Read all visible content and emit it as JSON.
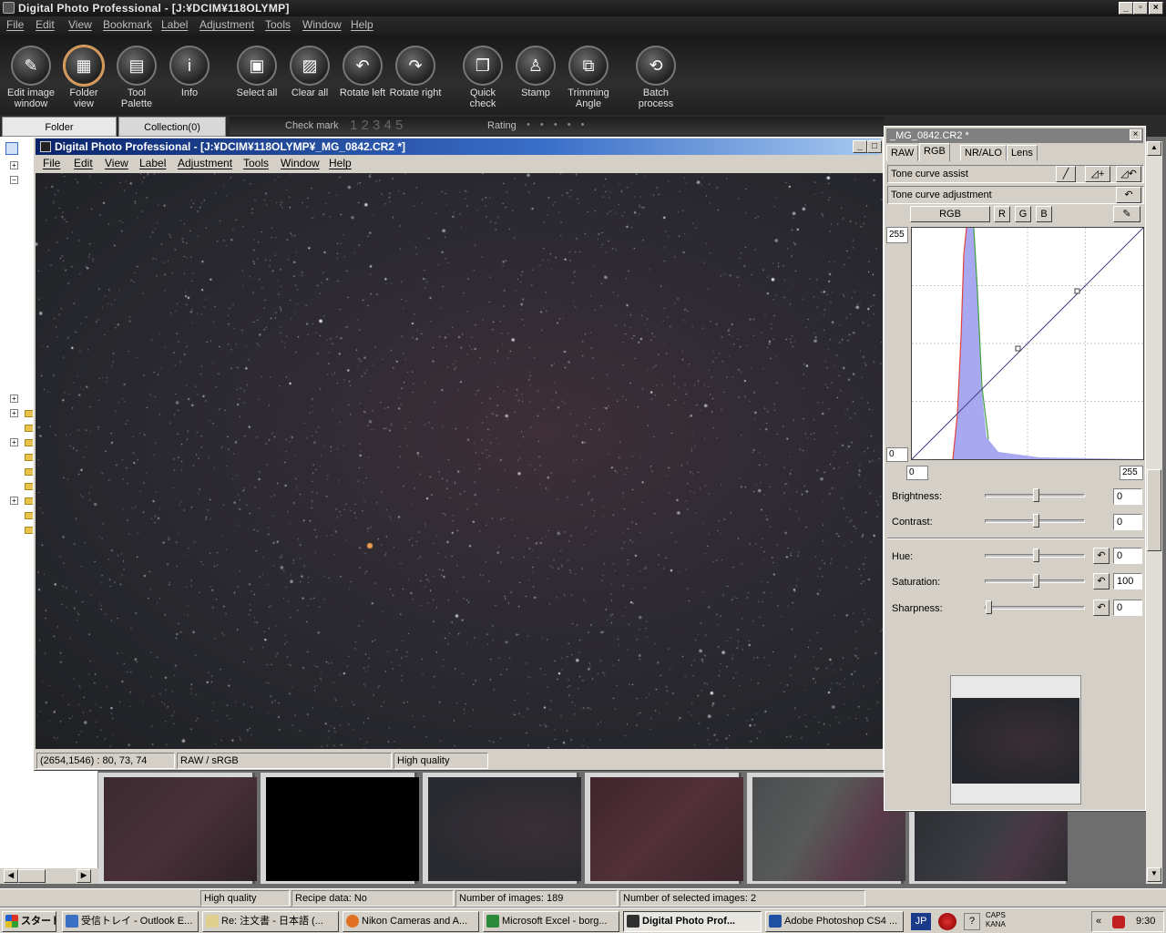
{
  "app": {
    "title": "Digital Photo Professional - [J:¥DCIM¥118OLYMP]"
  },
  "menu": [
    "File",
    "Edit",
    "View",
    "Bookmark",
    "Label",
    "Adjustment",
    "Tools",
    "Window",
    "Help"
  ],
  "toolbar": [
    {
      "label1": "Edit image",
      "label2": "window",
      "icon": "edit-image-icon"
    },
    {
      "label1": "Folder",
      "label2": "view",
      "icon": "folder-view-icon"
    },
    {
      "label1": "Tool",
      "label2": "Palette",
      "icon": "tool-palette-icon"
    },
    {
      "label1": "Info",
      "label2": "",
      "icon": "info-icon"
    },
    {
      "label1": "Select all",
      "label2": "",
      "icon": "select-all-icon"
    },
    {
      "label1": "Clear all",
      "label2": "",
      "icon": "clear-all-icon"
    },
    {
      "label1": "Rotate left",
      "label2": "",
      "icon": "rotate-left-icon"
    },
    {
      "label1": "Rotate right",
      "label2": "",
      "icon": "rotate-right-icon"
    },
    {
      "label1": "Quick",
      "label2": "check",
      "icon": "quick-check-icon"
    },
    {
      "label1": "Stamp",
      "label2": "",
      "icon": "stamp-icon"
    },
    {
      "label1": "Trimming",
      "label2": "Angle",
      "icon": "trimming-angle-icon"
    },
    {
      "label1": "Batch",
      "label2": "process",
      "icon": "batch-process-icon"
    }
  ],
  "tabs": {
    "folder": "Folder",
    "collection": "Collection(0)"
  },
  "checkrow": {
    "check_label": "Check mark",
    "check_nums": "1 2 3 4 5",
    "rating_label": "Rating",
    "rating_dots": "• • • • •"
  },
  "inner": {
    "title": "Digital Photo Professional - [J:¥DCIM¥118OLYMP¥_MG_0842.CR2 *]",
    "menu": [
      "File",
      "Edit",
      "View",
      "Label",
      "Adjustment",
      "Tools",
      "Window",
      "Help"
    ],
    "status": {
      "coords": "(2654,1546) : 80, 73, 74",
      "format": "RAW / sRGB",
      "quality": "High quality"
    }
  },
  "palette": {
    "title": "_MG_0842.CR2 *",
    "tabs": [
      "RAW",
      "RGB",
      "NR/ALO",
      "Lens"
    ],
    "tone_assist": "Tone curve assist",
    "tone_adjust": "Tone curve adjustment",
    "channels": [
      "RGB",
      "R",
      "G",
      "B"
    ],
    "curve": {
      "y_max": "255",
      "y_min": "0",
      "x_min": "0",
      "x_max": "255"
    },
    "sliders": [
      {
        "name": "Brightness:",
        "value": "0",
        "pos": 0.5
      },
      {
        "name": "Contrast:",
        "value": "0",
        "pos": 0.5
      },
      {
        "name": "Hue:",
        "value": "0",
        "pos": 0.5
      },
      {
        "name": "Saturation:",
        "value": "100",
        "pos": 0.5
      },
      {
        "name": "Sharpness:",
        "value": "0",
        "pos": 0.0
      }
    ]
  },
  "status": {
    "quality": "High quality",
    "recipe": "Recipe data: No",
    "count": "Number of images: 189",
    "selected": "Number of selected images: 2"
  },
  "taskbar": {
    "start": "スタート",
    "tasks": [
      {
        "label": "受信トレイ - Outlook E...",
        "color": "#3a6fc4"
      },
      {
        "label": "Re: 注文書 - 日本語 (...",
        "color": "#e0d090"
      },
      {
        "label": "Nikon Cameras and A...",
        "color": "#e07020"
      },
      {
        "label": "Microsoft Excel - borg...",
        "color": "#2a8a3a"
      },
      {
        "label": "Digital Photo Prof...",
        "color": "#303030"
      },
      {
        "label": "Adobe Photoshop CS4 ...",
        "color": "#2050a0"
      }
    ],
    "lang": "JP",
    "caps": "CAPS",
    "kana": "KANA",
    "clock": "9:30"
  }
}
